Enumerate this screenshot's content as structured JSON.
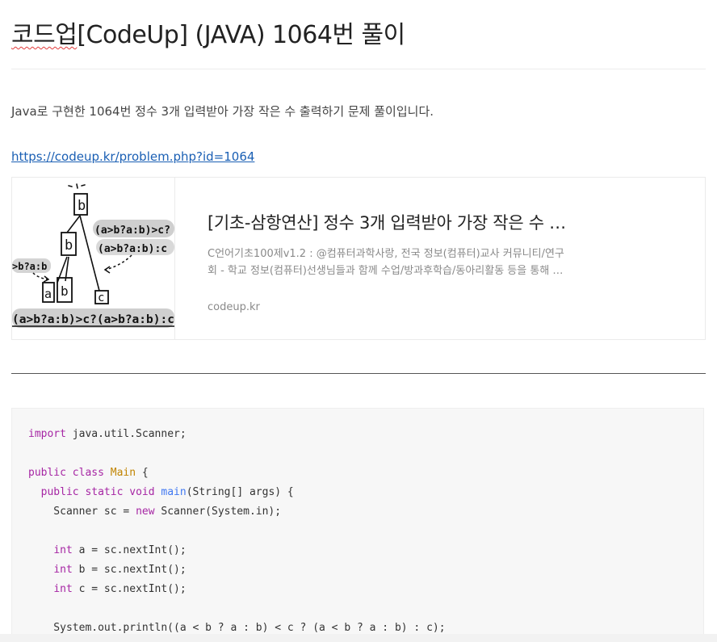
{
  "post": {
    "title_prefix": "코드업",
    "title_rest": "[CodeUp] (JAVA) 1064번 풀이",
    "intro": "Java로 구현한 1064번 정수 3개 입력받아 가장 작은 수 출력하기 문제 풀이입니다.",
    "link_text": "https://codeup.kr/problem.php?id=1064"
  },
  "card": {
    "title": "[기초-삼항연산] 정수 3개 입력받아 가장 작은 수 …",
    "desc_line1": "C언어기초100제v1.2 : @컴퓨터과학사랑, 전국 정보(컴퓨터)교사 커뮤니티/연구",
    "desc_line2": "회 - 학교 정보(컴퓨터)선생님들과 함께 수업/방과후학습/동아리활동 등을 통해 …",
    "domain": "codeup.kr",
    "thumb": {
      "label_b_top": "b",
      "label_b_mid": "b",
      "label_a": "a",
      "label_b_low": "b",
      "label_c": "c",
      "expr_top": "(a>b?a:b)>c?",
      "expr_mid": "(a>b?a:b):c",
      "expr_left": ">b?a:b",
      "expr_bottom": "(a>b?a:b)>c?(a>b?a:b):c"
    }
  },
  "code": {
    "l1_kw": "import",
    "l1_rest": " java.util.Scanner;",
    "l3_kw1": "public",
    "l3_kw2": "class",
    "l3_cls": "Main",
    "l3_rest": " {",
    "l4_indent": "  ",
    "l4_kw1": "public",
    "l4_kw2": "static",
    "l4_kw3": "void",
    "l4_fn": "main",
    "l4_rest": "(String[] args) {",
    "l5_pre": "    Scanner sc = ",
    "l5_kw": "new",
    "l5_rest": " Scanner(System.in);",
    "l7_indent": "    ",
    "l7_kw": "int",
    "l7_rest": " a = sc.nextInt();",
    "l8_indent": "    ",
    "l8_kw": "int",
    "l8_rest": " b = sc.nextInt();",
    "l9_indent": "    ",
    "l9_kw": "int",
    "l9_rest": " c = sc.nextInt();",
    "l11": "    System.out.println((a < b ? a : b) < c ? (a < b ? a : b) : c);"
  }
}
